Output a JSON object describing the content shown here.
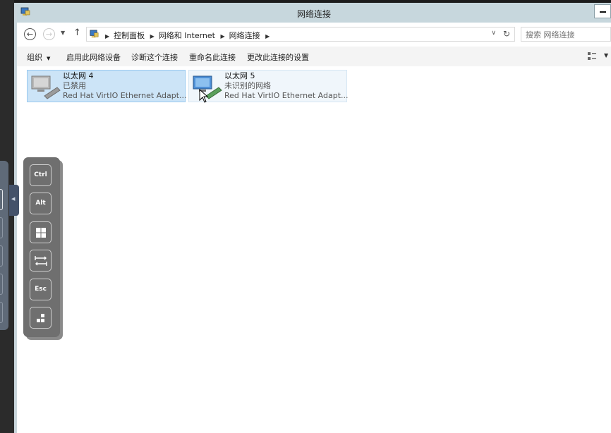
{
  "window": {
    "title": "网络连接"
  },
  "address_bar": {
    "breadcrumb": [
      "控制面板",
      "网络和 Internet",
      "网络连接"
    ],
    "search_placeholder": "搜索 网络连接"
  },
  "command_bar": {
    "organize": "组织",
    "enable_device": "启用此网络设备",
    "diagnose": "诊断这个连接",
    "rename": "重命名此连接",
    "change_settings": "更改此连接的设置"
  },
  "connections": [
    {
      "name": "以太网 4",
      "status": "已禁用",
      "adapter": "Red Hat VirtIO Ethernet Adapt...",
      "state": "disabled",
      "selected": true
    },
    {
      "name": "以太网 5",
      "status": "未识别的网络",
      "adapter": "Red Hat VirtIO Ethernet Adapt...",
      "state": "enabled",
      "selected": false
    }
  ],
  "keyboard_panel": {
    "keys": [
      "Ctrl",
      "Alt",
      "windows-icon",
      "tab-icon",
      "Esc",
      "apps-icon"
    ],
    "labels": {
      "ctrl": "Ctrl",
      "alt": "Alt",
      "esc": "Esc"
    }
  },
  "colors": {
    "titlebar": "#c7d7dd",
    "selection": "#cce4f7",
    "panel": "#6f6f6f"
  }
}
